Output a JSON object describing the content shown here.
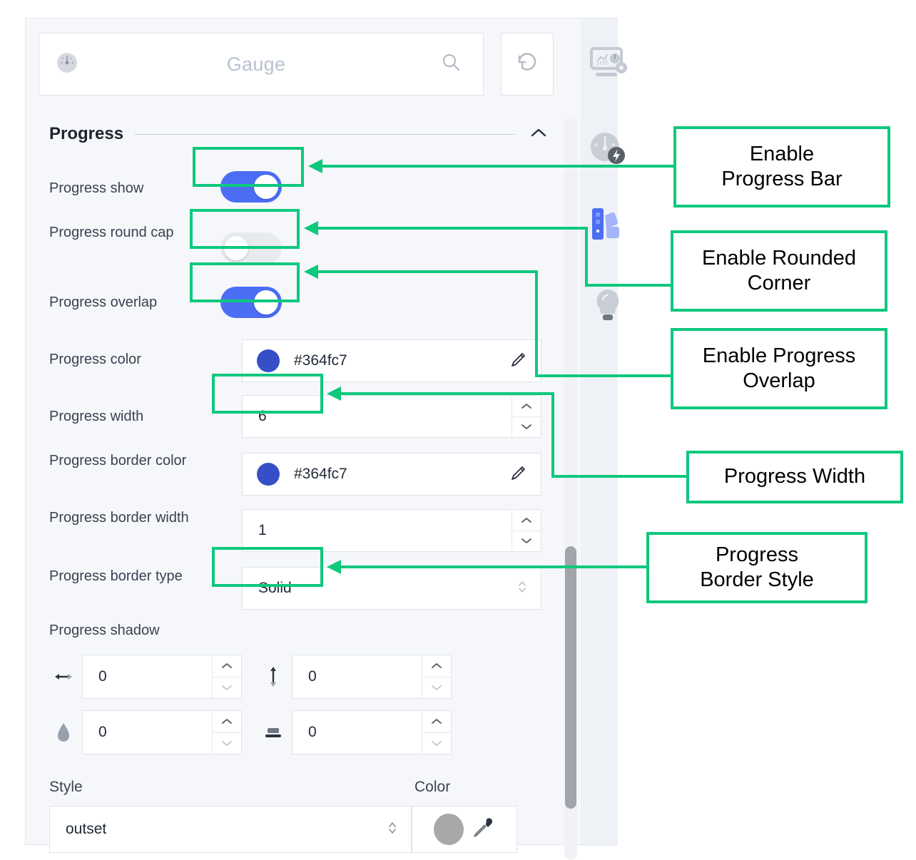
{
  "colors": {
    "accent_green": "#0ec87d",
    "toggle_on": "#4c6ef5",
    "toggle_off": "#e7eaee",
    "progress_color": "#364fc7",
    "panel_bg": "#f5f7fa",
    "rail_bg": "#eef1f5"
  },
  "search": {
    "value": "Gauge",
    "icon": "gauge-icon",
    "search_icon": "search-icon",
    "refresh_icon": "refresh-icon"
  },
  "section": {
    "title": "Progress",
    "collapse_icon": "chevron-up-icon"
  },
  "fields": {
    "progress_show": {
      "label": "Progress show",
      "value": "on"
    },
    "progress_round_cap": {
      "label": "Progress round cap",
      "value": "off"
    },
    "progress_overlap": {
      "label": "Progress overlap",
      "value": "on"
    },
    "progress_color": {
      "label": "Progress color",
      "value": "#364fc7",
      "edit_icon": "pencil-icon"
    },
    "progress_width": {
      "label": "Progress width",
      "value": "6"
    },
    "progress_border_color": {
      "label": "Progress border color",
      "value": "#364fc7",
      "edit_icon": "pencil-icon"
    },
    "progress_border_width": {
      "label": "Progress border width",
      "value": "1"
    },
    "progress_border_type": {
      "label": "Progress border type",
      "value": "Solid"
    },
    "progress_shadow": {
      "label": "Progress shadow"
    }
  },
  "shadow": {
    "offset_x": {
      "value": "0",
      "icon": "horizontal-arrows-icon"
    },
    "offset_y": {
      "value": "0",
      "icon": "vertical-arrows-icon"
    },
    "blur": {
      "value": "0",
      "icon": "blur-drop-icon"
    },
    "spread": {
      "value": "0",
      "icon": "spread-icon"
    }
  },
  "style_section": {
    "style_label": "Style",
    "style_value": "outset",
    "color_label": "Color",
    "color_swatch": "#a8a8a8",
    "picker_icon": "eyedropper-icon"
  },
  "rail": {
    "items": [
      {
        "name": "dashboard-settings-icon"
      },
      {
        "name": "gauge-lightning-icon"
      },
      {
        "name": "palette-swatches-icon",
        "active": true
      },
      {
        "name": "lightbulb-icon"
      }
    ]
  },
  "annotations": [
    {
      "id": "enable-progress-bar",
      "text": "Enable\nProgress Bar"
    },
    {
      "id": "enable-rounded-corner",
      "text": "Enable Rounded\nCorner"
    },
    {
      "id": "enable-progress-overlap",
      "text": "Enable Progress\nOverlap"
    },
    {
      "id": "progress-width",
      "text": "Progress Width"
    },
    {
      "id": "progress-border-style",
      "text": "Progress\nBorder Style"
    }
  ]
}
